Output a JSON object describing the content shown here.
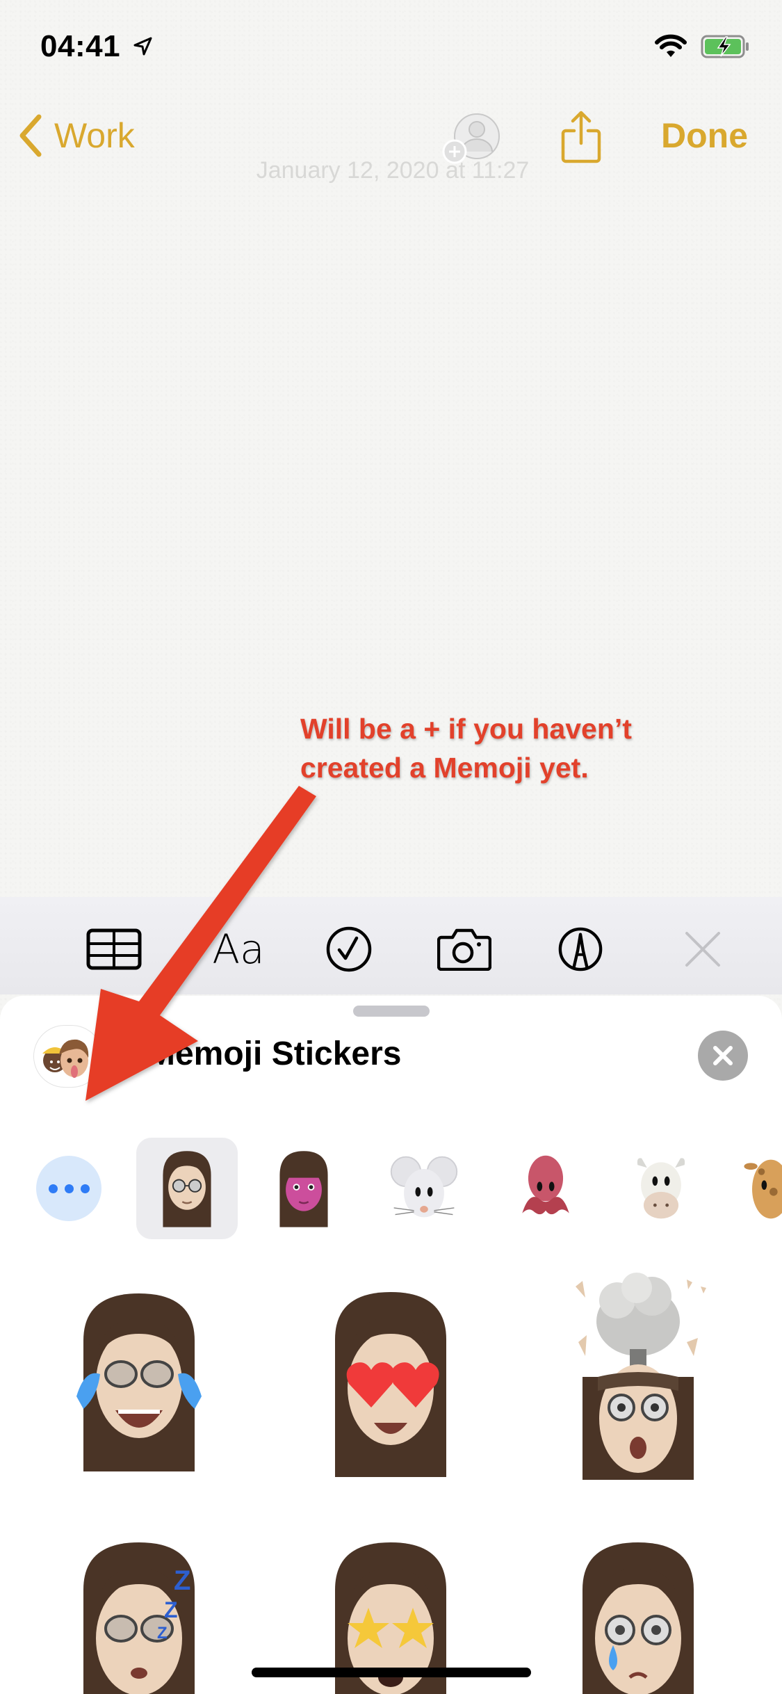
{
  "status_bar": {
    "time": "04:41",
    "icons": [
      "location-arrow-icon",
      "wifi-icon",
      "battery-charging-icon"
    ]
  },
  "nav": {
    "back_label": "Work",
    "done_label": "Done",
    "note_date": "January 12, 2020 at 11:27",
    "icons": [
      "chevron-left-icon",
      "add-collaborator-icon",
      "share-icon"
    ]
  },
  "colors": {
    "accent": "#D9A82E",
    "annotation": "#E2412B",
    "more_button_bg": "#D8E8FB",
    "more_button_dots": "#2F7CF6",
    "close_button_bg": "#A9A9A9"
  },
  "annotation": {
    "line1": "Will be a + if you haven’t",
    "line2": "created a Memoji yet."
  },
  "toolbar": {
    "tools": [
      {
        "name": "table",
        "icon": "table-icon"
      },
      {
        "name": "format",
        "label": "Aa"
      },
      {
        "name": "checklist",
        "icon": "checkmark-circle-icon"
      },
      {
        "name": "camera",
        "icon": "camera-icon"
      },
      {
        "name": "markup",
        "icon": "pen-tip-circle-icon"
      },
      {
        "name": "dismiss",
        "icon": "close-icon"
      }
    ]
  },
  "sheet": {
    "title": "Memoji Stickers",
    "more_button": "more-options",
    "characters": [
      {
        "name": "my-memoji",
        "selected": true
      },
      {
        "name": "memoji-pink",
        "selected": false
      },
      {
        "name": "mouse",
        "selected": false
      },
      {
        "name": "octopus",
        "selected": false
      },
      {
        "name": "cow",
        "selected": false
      },
      {
        "name": "giraffe",
        "selected": false
      }
    ],
    "stickers": [
      {
        "expression": "tears-of-joy"
      },
      {
        "expression": "heart-eyes"
      },
      {
        "expression": "mind-blown"
      },
      {
        "expression": "sleeping"
      },
      {
        "expression": "star-struck"
      },
      {
        "expression": "crying"
      }
    ]
  }
}
